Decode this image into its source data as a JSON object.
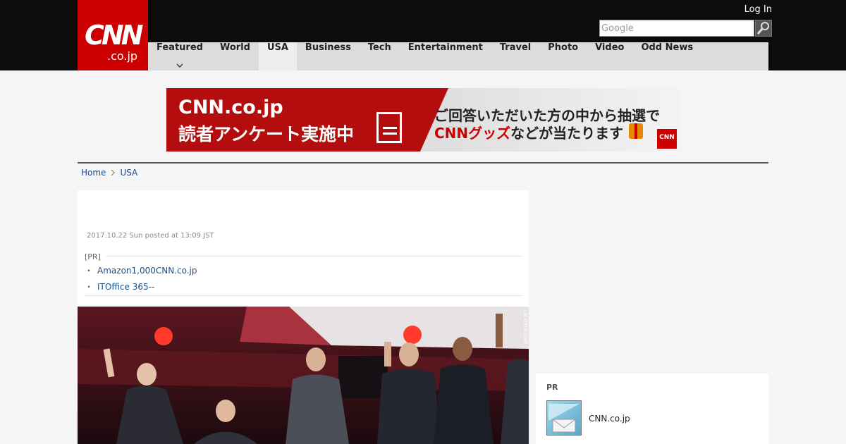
{
  "header": {
    "logo_main": "CNN",
    "logo_sub": ".co.jp",
    "login_label": "Log In",
    "search_placeholder": "Google"
  },
  "nav": {
    "items": [
      {
        "label": "Featured"
      },
      {
        "label": "World"
      },
      {
        "label": "USA",
        "active": true
      },
      {
        "label": "Business"
      },
      {
        "label": "Tech"
      },
      {
        "label": "Entertainment"
      },
      {
        "label": "Travel"
      },
      {
        "label": "Photo"
      },
      {
        "label": "Video"
      },
      {
        "label": "Odd News"
      }
    ]
  },
  "banner": {
    "line1": "CNN.co.jp",
    "line2": "読者アンケート実施中",
    "right1": "ご回答いただいた方の中から抽選で",
    "right2_red": "CNNグッズ",
    "right2_rest": "などが当たります",
    "mini_logo": "CNN"
  },
  "breadcrumb": {
    "home": "Home",
    "current": "USA"
  },
  "article": {
    "date": "2017.10.22 Sun posted at 13:09 JST",
    "pr_label": "[PR]",
    "pr_links": [
      "Amazon1,000CNN.co.jp",
      "ITOffice 365--"
    ],
    "photo_credit": "LM OTERO/AP"
  },
  "sidebar": {
    "pr_title": "PR",
    "pr_item_text": "CNN.co.jp"
  },
  "colors": {
    "brand_red": "#cc0000",
    "header_black": "#0c0c0c",
    "nav_gray": "#dcdcdc",
    "link_blue": "#1a4f8a"
  }
}
